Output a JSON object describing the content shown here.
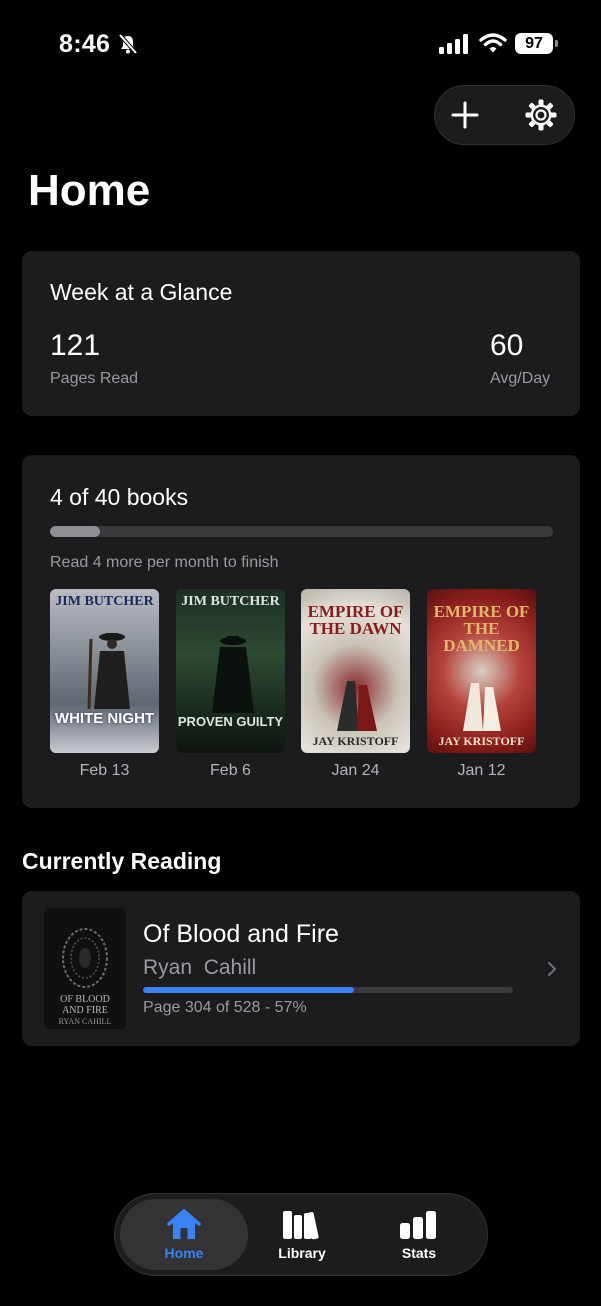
{
  "status_bar": {
    "time": "8:46",
    "battery": "97"
  },
  "page_title": "Home",
  "week": {
    "title": "Week at a Glance",
    "pages_read": "121",
    "pages_read_label": "Pages Read",
    "avg_day": "60",
    "avg_day_label": "Avg/Day"
  },
  "goal": {
    "title": "4 of 40 books",
    "progress_fraction": 0.1,
    "hint": "Read 4 more per month to finish",
    "books": [
      {
        "author": "JIM BUTCHER",
        "title": "WHITE NIGHT",
        "date": "Feb 13"
      },
      {
        "author": "JIM BUTCHER",
        "title": "PROVEN GUILTY",
        "date": "Feb 6"
      },
      {
        "author": "JAY KRISTOFF",
        "title": "EMPIRE OF THE DAWN",
        "date": "Jan 24"
      },
      {
        "author": "JAY KRISTOFF",
        "title": "EMPIRE OF THE DAMNED",
        "date": "Jan 12"
      }
    ]
  },
  "currently_reading": {
    "section_title": "Currently Reading",
    "title": "Of Blood and Fire",
    "author": "Ryan  Cahill",
    "progress_fraction": 0.57,
    "page_text": "Page 304 of 528 - 57%",
    "cover_title": "OF BLOOD AND FIRE",
    "cover_author": "RYAN CAHILL"
  },
  "tabs": [
    {
      "label": "Home",
      "icon": "home-icon",
      "active": true
    },
    {
      "label": "Library",
      "icon": "library-icon",
      "active": false
    },
    {
      "label": "Stats",
      "icon": "stats-icon",
      "active": false
    }
  ],
  "colors": {
    "accent": "#3a82f6",
    "card": "#1c1c1e",
    "background": "#000000"
  }
}
